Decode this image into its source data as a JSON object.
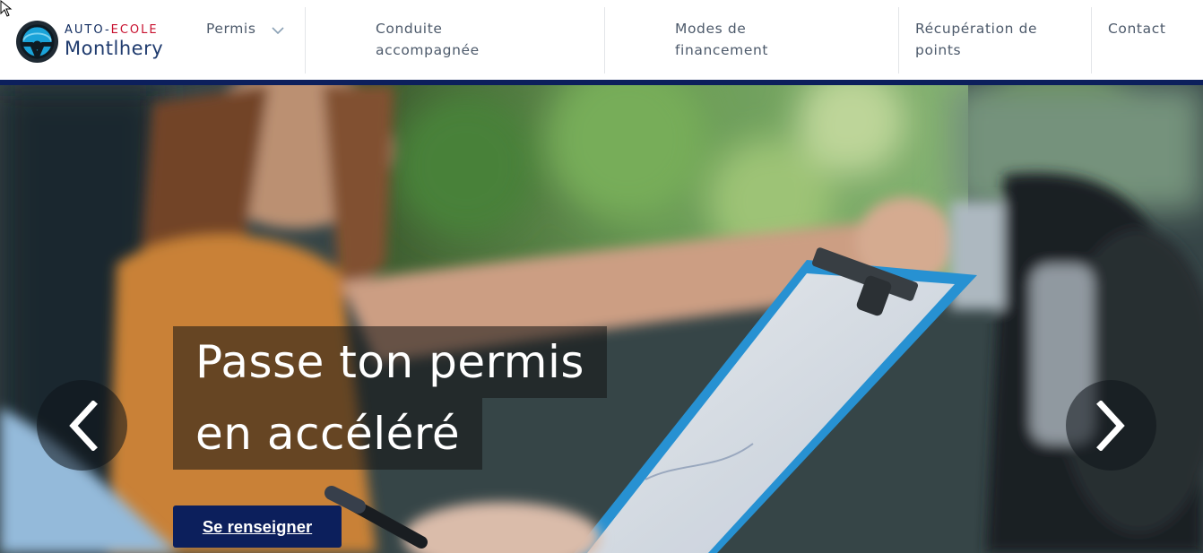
{
  "brand": {
    "line1_prefix": "AUTO-",
    "line1_accent": "ECOLE",
    "line2": "Montlhery",
    "logo_icon": "steering-wheel-icon"
  },
  "nav": {
    "items": [
      {
        "label": "Permis",
        "has_dropdown": true
      },
      {
        "label": "Conduite\naccompagnée"
      },
      {
        "label": "Modes de\nfinancement"
      },
      {
        "label": "Récupération de\npoints"
      },
      {
        "label": "Contact"
      }
    ]
  },
  "hero": {
    "headline_line1": "Passe ton permis",
    "headline_line2": "en accéléré",
    "cta_label": "Se renseigner",
    "prev_icon": "chevron-left-icon",
    "next_icon": "chevron-right-icon"
  },
  "colors": {
    "brand_navy": "#0c1f5c",
    "brand_red": "#c8102e",
    "nav_text": "#4d5a6b"
  }
}
